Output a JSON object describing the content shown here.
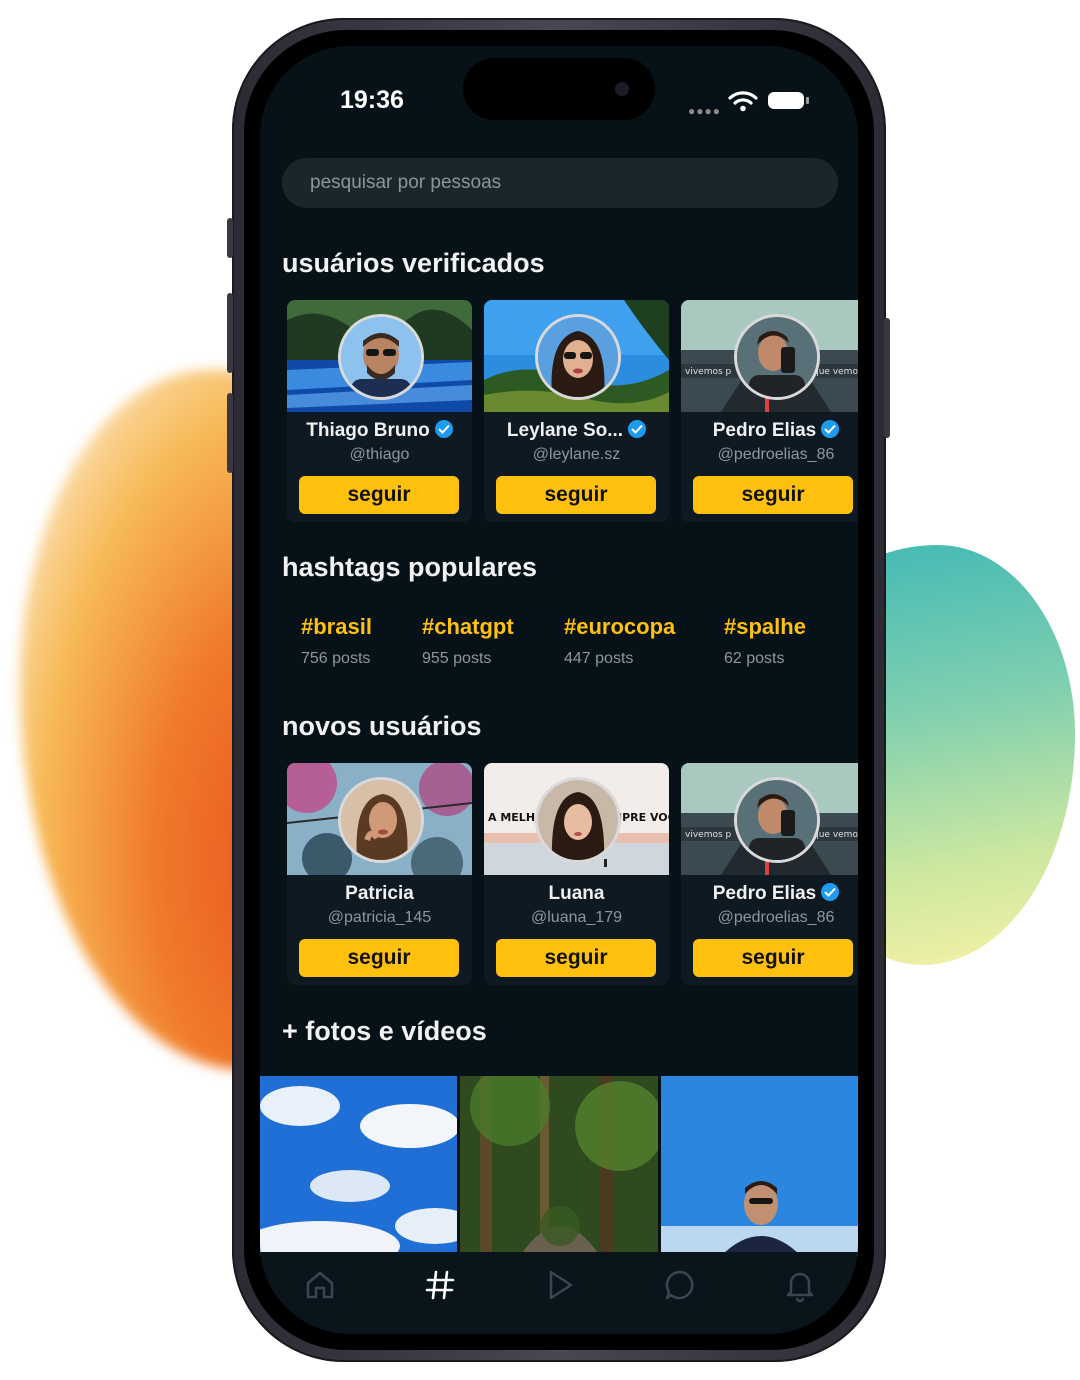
{
  "status_bar": {
    "time": "19:36"
  },
  "search": {
    "placeholder": "pesquisar por pessoas"
  },
  "sections": {
    "verified_title": "usuários verificados",
    "hashtags_title": "hashtags populares",
    "new_users_title": "novos usuários",
    "media_title": "+ fotos e vídeos"
  },
  "verified_users": [
    {
      "name": "Thiago Bruno",
      "handle": "@thiago",
      "verified": true,
      "button": "seguir"
    },
    {
      "name": "Leylane So...",
      "handle": "@leylane.sz",
      "verified": true,
      "button": "seguir"
    },
    {
      "name": "Pedro Elias",
      "handle": "@pedroelias_86",
      "verified": true,
      "button": "seguir"
    }
  ],
  "hashtags": [
    {
      "tag": "#brasil",
      "count": "756 posts"
    },
    {
      "tag": "#chatgpt",
      "count": "955 posts"
    },
    {
      "tag": "#eurocopa",
      "count": "447 posts"
    },
    {
      "tag": "#spalhe",
      "count": "62 posts"
    }
  ],
  "new_users": [
    {
      "name": "Patricia",
      "handle": "@patricia_145",
      "verified": false,
      "button": "seguir"
    },
    {
      "name": "Luana",
      "handle": "@luana_179",
      "verified": false,
      "button": "seguir"
    },
    {
      "name": "Pedro Elias",
      "handle": "@pedroelias_86",
      "verified": true,
      "button": "seguir"
    }
  ],
  "tabs": [
    {
      "icon": "home-icon",
      "active": false
    },
    {
      "icon": "hashtag-icon",
      "active": true
    },
    {
      "icon": "play-icon",
      "active": false
    },
    {
      "icon": "chat-bubble-icon",
      "active": false
    },
    {
      "icon": "bell-icon",
      "active": false
    }
  ],
  "colors": {
    "accent": "#ffc10e",
    "background": "#061118",
    "card": "#0e1921",
    "verified": "#1d9bf0"
  }
}
